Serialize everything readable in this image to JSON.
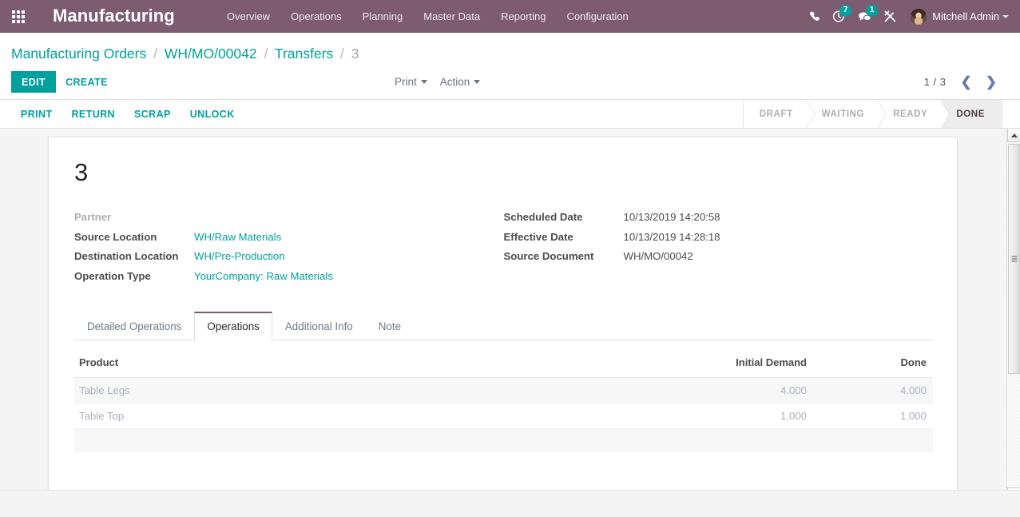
{
  "navbar": {
    "apps_icon": "apps-grid-icon",
    "brand": "Manufacturing",
    "menu": [
      {
        "label": "Overview"
      },
      {
        "label": "Operations"
      },
      {
        "label": "Planning"
      },
      {
        "label": "Master Data"
      },
      {
        "label": "Reporting"
      },
      {
        "label": "Configuration"
      }
    ],
    "systray": {
      "phone_icon": "phone-icon",
      "activity_icon": "clock-activity-icon",
      "activity_count": "7",
      "messaging_icon": "chat-bubble-icon",
      "messaging_count": "1",
      "tools_icon": "wrench-screwdriver-icon",
      "user_name": "Mitchell Admin",
      "avatar_icon": "user-avatar",
      "caret_icon": "caret-down-icon"
    },
    "colors": {
      "brand_bg": "#7d5b71",
      "accent": "#00A09D",
      "badge": "#00A09D"
    }
  },
  "control_panel": {
    "breadcrumb": [
      {
        "label": "Manufacturing Orders",
        "link": true
      },
      {
        "label": "WH/MO/00042",
        "link": true
      },
      {
        "label": "Transfers",
        "link": true
      },
      {
        "label": "3",
        "link": false
      }
    ],
    "separator": "/",
    "edit_label": "EDIT",
    "create_label": "CREATE",
    "print_label": "Print",
    "action_label": "Action",
    "pager_value": "1 / 3",
    "pager_prev_icon": "chevron-left-icon",
    "pager_next_icon": "chevron-right-icon"
  },
  "sheet_bar": {
    "buttons": [
      {
        "label": "PRINT"
      },
      {
        "label": "RETURN"
      },
      {
        "label": "SCRAP"
      },
      {
        "label": "UNLOCK"
      }
    ],
    "statusbar": [
      {
        "label": "DRAFT",
        "active": false
      },
      {
        "label": "WAITING",
        "active": false
      },
      {
        "label": "READY",
        "active": false
      },
      {
        "label": "DONE",
        "active": true
      }
    ]
  },
  "record": {
    "title": "3",
    "left_fields": [
      {
        "label": "Partner",
        "value": "",
        "muted_label": true,
        "link": false
      },
      {
        "label": "Source Location",
        "value": "WH/Raw Materials",
        "link": true
      },
      {
        "label": "Destination Location",
        "value": "WH/Pre-Production",
        "link": true
      },
      {
        "label": "Operation Type",
        "value": "YourCompany: Raw Materials",
        "link": true
      }
    ],
    "right_fields": [
      {
        "label": "Scheduled Date",
        "value": "10/13/2019 14:20:58",
        "link": false
      },
      {
        "label": "Effective Date",
        "value": "10/13/2019 14:28:18",
        "link": false
      },
      {
        "label": "Source Document",
        "value": "WH/MO/00042",
        "link": false
      }
    ]
  },
  "notebook": {
    "tabs": [
      {
        "label": "Detailed Operations",
        "active": false
      },
      {
        "label": "Operations",
        "active": true
      },
      {
        "label": "Additional Info",
        "active": false
      },
      {
        "label": "Note",
        "active": false
      }
    ]
  },
  "operations_table": {
    "columns": [
      {
        "label": "Product",
        "align": "left"
      },
      {
        "label": "Initial Demand",
        "align": "right"
      },
      {
        "label": "Done",
        "align": "right"
      }
    ],
    "rows": [
      {
        "product": "Table Legs",
        "initial_demand": "4.000",
        "done": "4.000"
      },
      {
        "product": "Table Top",
        "initial_demand": "1.000",
        "done": "1.000"
      }
    ]
  },
  "scrollbar": {
    "up_icon": "scroll-up-arrow-icon",
    "down_icon": "scroll-down-arrow-icon",
    "thumb": "scroll-thumb"
  }
}
